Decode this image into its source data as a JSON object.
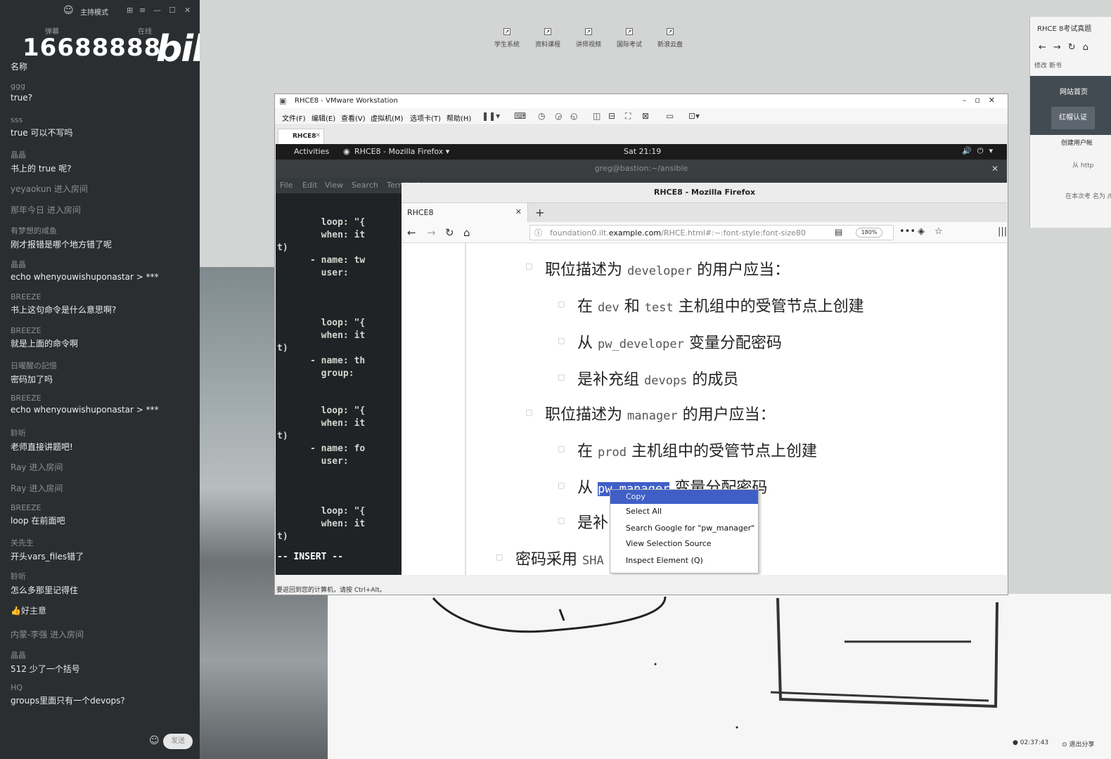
{
  "chat": {
    "title": "主持模式",
    "tab_left": "弹幕",
    "tab_right": "在线",
    "counter": "16688888",
    "logo": "bilibili",
    "name_label": "名称",
    "messages": [
      {
        "user": "ggg",
        "text": "true?"
      },
      {
        "user": "sss",
        "text": "true 可以不写吗"
      },
      {
        "user": "晶晶",
        "text": "书上的 true 呢?"
      },
      {
        "join": "yeyaokun 进入房间"
      },
      {
        "join": "那年今日 进入房间"
      },
      {
        "user": "有梦想的咸鱼",
        "text": "刚才报错是哪个地方错了呢"
      },
      {
        "user": "晶晶",
        "text": "echo whenyouwishuponastar > ***"
      },
      {
        "user": "BREEZE",
        "text": "书上这句命令是什么意思啊?"
      },
      {
        "user": "BREEZE",
        "text": "就是上面的命令啊"
      },
      {
        "user": "日曜醒の記憶",
        "text": "密码加了吗"
      },
      {
        "user": "BREEZE",
        "text": "echo whenyouwishuponastar > ***"
      },
      {
        "user": "聆听",
        "text": "老师直接讲题吧!"
      },
      {
        "join": "Ray 进入房间"
      },
      {
        "join": "Ray 进入房间"
      },
      {
        "user": "BREEZE",
        "text": "loop 在前面吧"
      },
      {
        "user": "关先生",
        "text": "开头vars_files错了"
      },
      {
        "user": "聆听",
        "text": "怎么多那里记得住"
      },
      {
        "gift": "好主意"
      },
      {
        "join": "内蒙-李强 进入房间"
      },
      {
        "user": "晶晶",
        "text": "512 少了一个括号"
      },
      {
        "user": "HQ",
        "text": "groups里面只有一个devops?"
      }
    ],
    "send_label": "发送"
  },
  "desktop": {
    "shortcuts": [
      "学生系统",
      "资料课程",
      "讲师视频",
      "国际考试",
      "新浪云盘"
    ],
    "side_browser": {
      "tab": "RHCE 8考试真题",
      "bookmarks": "修改   新书",
      "home": "网站首页",
      "auth": "红帽认证",
      "heading": "创建用户帐",
      "text1": "从 http",
      "text2": "在本次考 名为 /hom"
    },
    "rec_time": "02:37:43",
    "exit_share": "退出分享"
  },
  "vmware": {
    "title": "RHCE8 - VMware Workstation",
    "menus": [
      "文件(F)",
      "编辑(E)",
      "查看(V)",
      "虚拟机(M)",
      "选项卡(T)",
      "帮助(H)"
    ],
    "tab": "RHCE8",
    "status": "要返回到您的计算机，请按 Ctrl+Alt。"
  },
  "gnome": {
    "activities": "Activities",
    "app": "RHCE8 - Mozilla Firefox ▾",
    "clock": "Sat 21:19"
  },
  "terminal": {
    "title": "greg@bastion:~/ansible",
    "menu": [
      "File",
      "Edit",
      "View",
      "Search",
      "Terminal"
    ],
    "lines": [
      {
        "text": "        loop: \"{",
        "y": 0
      },
      {
        "text": "        when: it",
        "y": 0
      },
      {
        "text": "t)",
        "y": 0
      },
      {
        "text": "      - name: tw",
        "y": 0
      },
      {
        "text": "        user:",
        "y": 0
      },
      {
        "text": "        loop: \"{",
        "y": 0
      },
      {
        "text": "        when: it",
        "y": 0
      },
      {
        "text": "t)",
        "y": 0
      },
      {
        "text": "      - name: th",
        "y": 0
      },
      {
        "text": "        group:",
        "y": 0
      },
      {
        "text": "        loop: \"{",
        "y": 0
      },
      {
        "text": "        when: it",
        "y": 0
      },
      {
        "text": "t)",
        "y": 0
      },
      {
        "text": "      - name: fo",
        "y": 0
      },
      {
        "text": "        user:",
        "y": 0
      },
      {
        "text": "        loop: \"{",
        "y": 0
      },
      {
        "text": "        when: it",
        "y": 0
      },
      {
        "text": "t)",
        "y": 0
      }
    ],
    "mode": "-- INSERT --"
  },
  "firefox": {
    "window_title": "RHCE8 - Mozilla Firefox",
    "tab_title": "RHCE8",
    "url_prefix": "foundation0.ilt.",
    "url_domain": "example.com",
    "url_rest": "/RHCE.html#:~:font-style:font-size80",
    "zoom": "180%",
    "content": {
      "l1": {
        "a": "职位描述为 ",
        "code": "developer",
        "b": " 的用户应当："
      },
      "l2": {
        "a": "在 ",
        "code": "dev",
        "b": " 和 ",
        "code2": "test",
        "c": " 主机组中的受管节点上创建"
      },
      "l3": {
        "a": "从 ",
        "code": "pw_developer",
        "b": " 变量分配密码"
      },
      "l4": {
        "a": "是补充组 ",
        "code": "devops",
        "b": " 的成员"
      },
      "l5": {
        "a": "职位描述为 ",
        "code": "manager",
        "b": " 的用户应当："
      },
      "l6": {
        "a": "在 ",
        "code": "prod",
        "b": " 主机组中的受管节点上创建"
      },
      "l7": {
        "a": "从 ",
        "code": "pw_manager",
        "b": " 变量分配密码"
      },
      "l8": {
        "a": "是补"
      },
      "l9": {
        "a": "密码采用 ",
        "code": "SHA"
      }
    },
    "context_menu": {
      "copy": "Copy",
      "select_all": "Select All",
      "search": "Search Google for \"pw_manager\"",
      "view_source": "View Selection Source",
      "inspect": "Inspect Element (Q)"
    }
  },
  "icons": [
    "user-avatar-icon",
    "back-icon",
    "forward-icon",
    "reload-icon",
    "home-icon",
    "info-icon",
    "reader-icon",
    "bookmark-star-icon",
    "pocket-icon",
    "more-icon",
    "close-icon",
    "volume-icon",
    "power-icon"
  ]
}
